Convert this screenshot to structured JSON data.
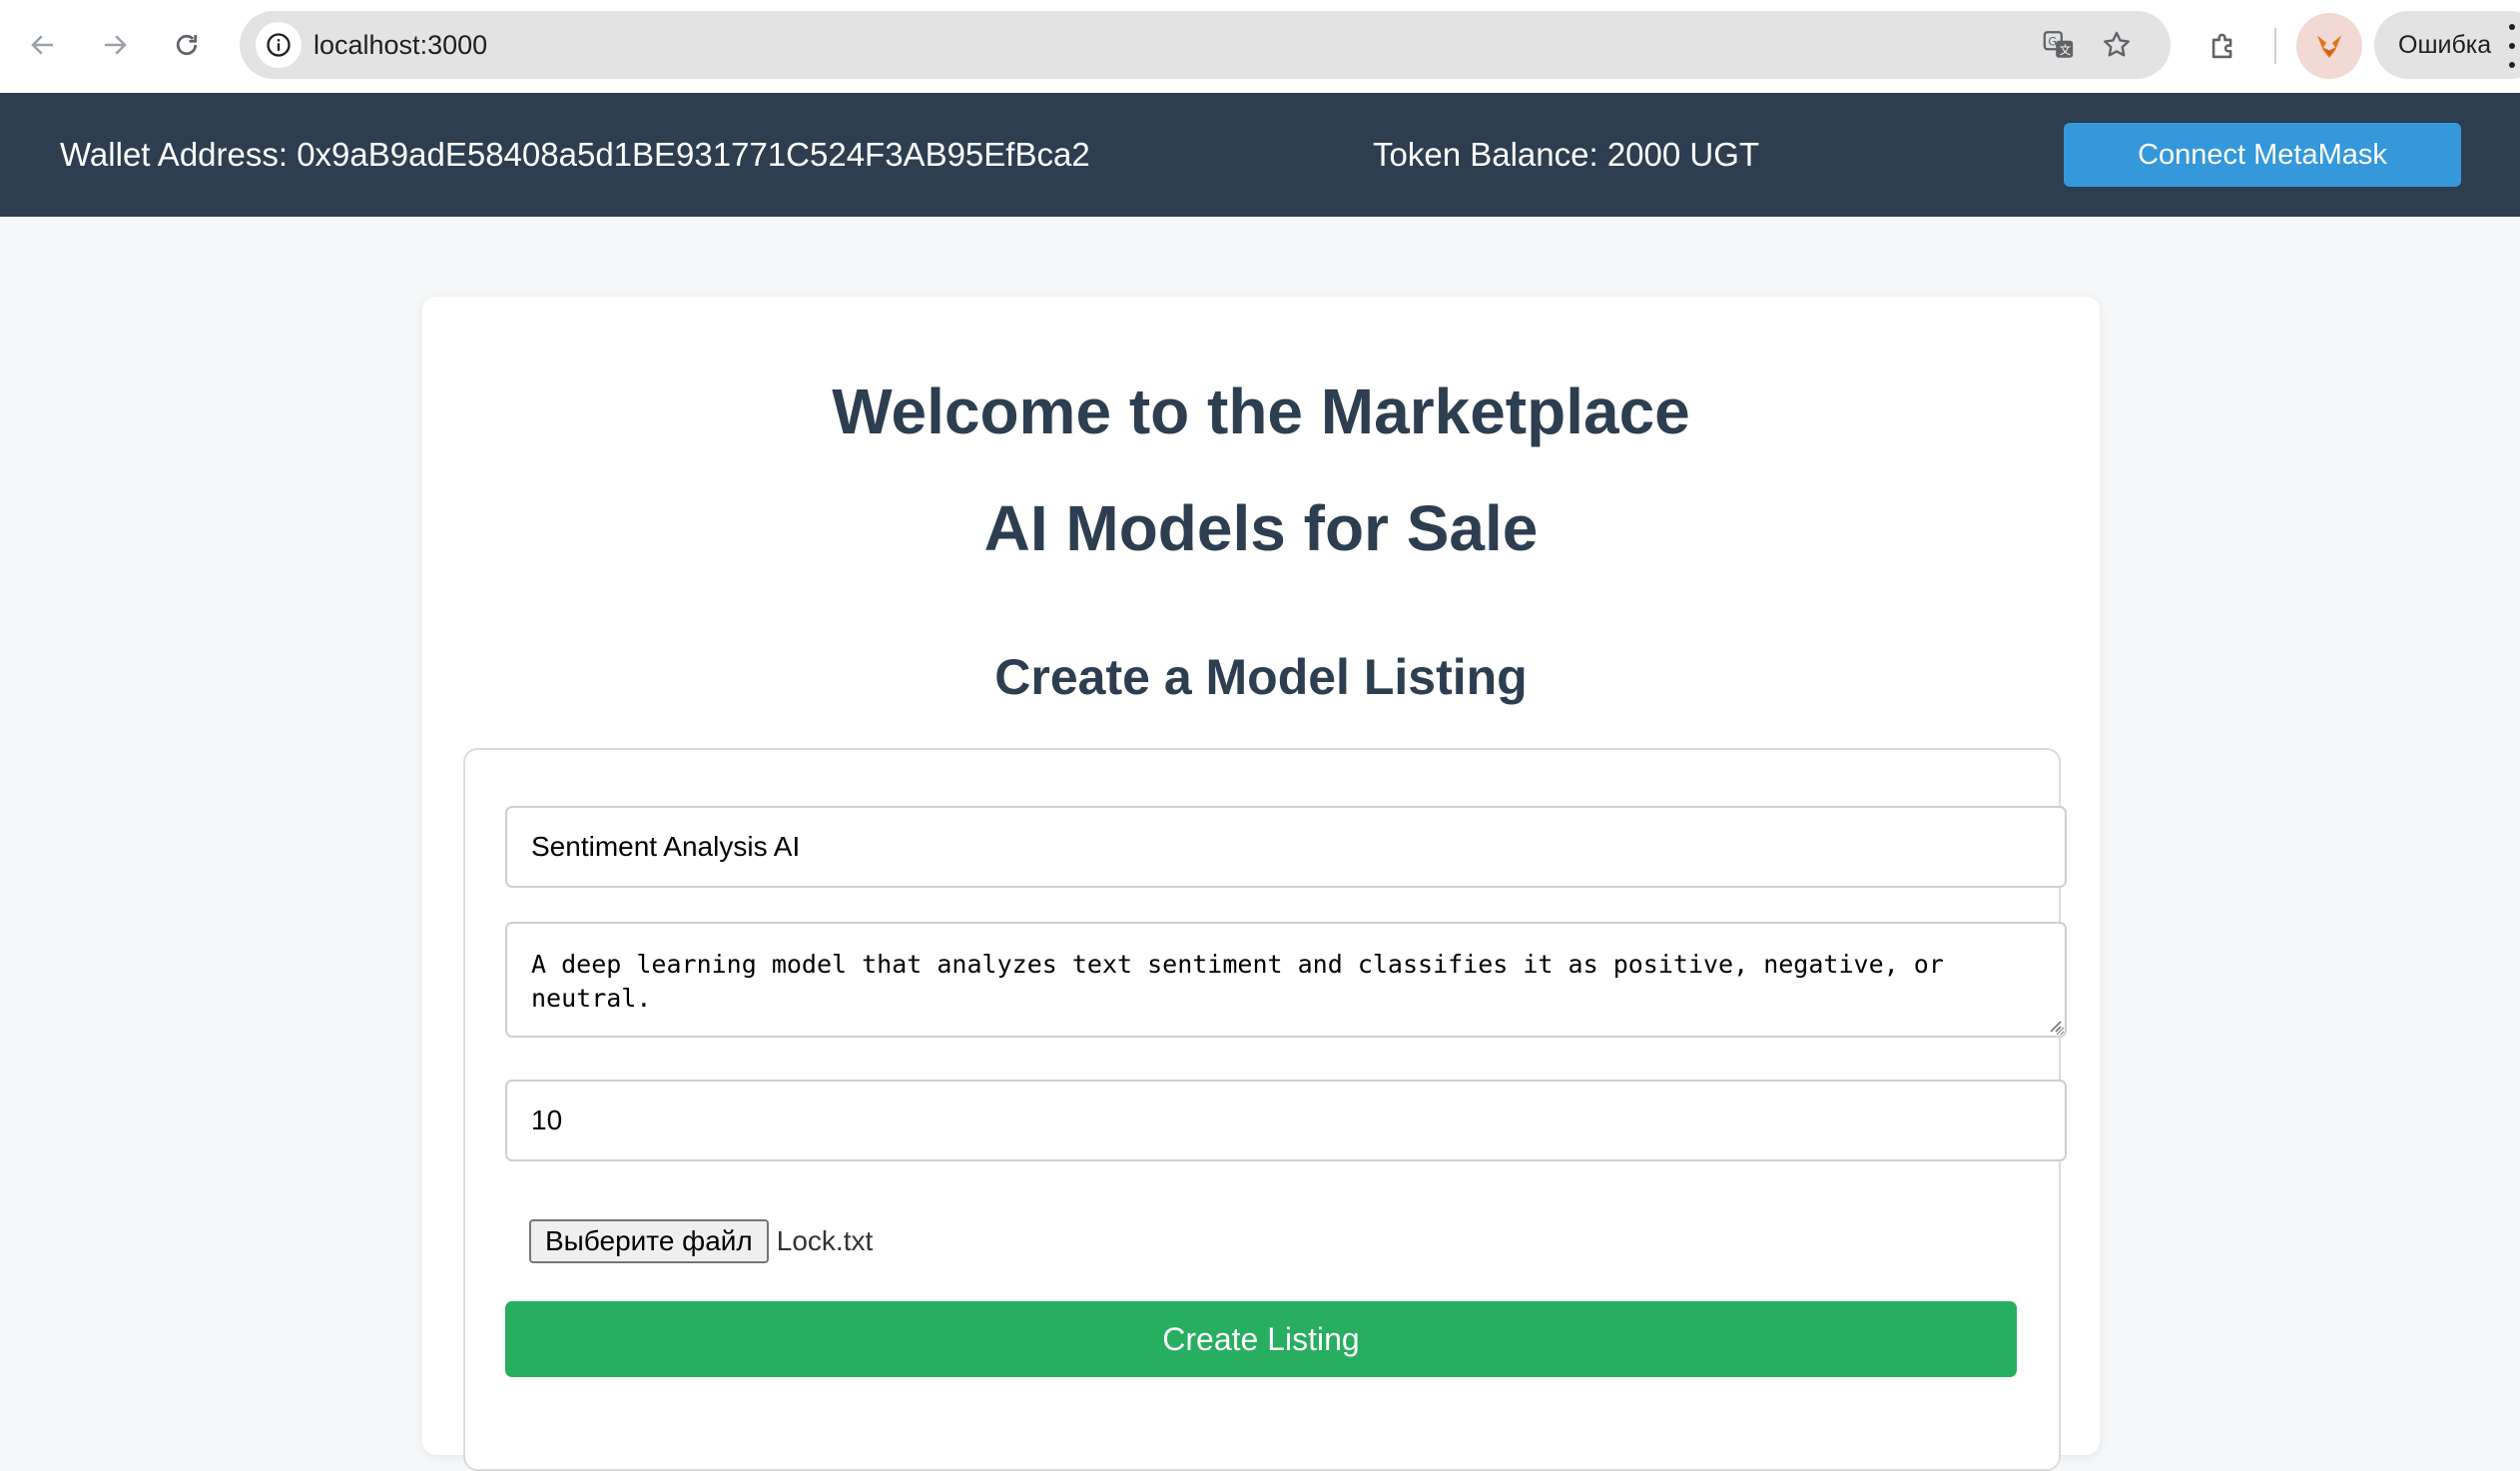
{
  "browser": {
    "url": "localhost:3000",
    "profile_label": "Ошибка",
    "icons": {
      "back": "arrow-left-icon",
      "forward": "arrow-right-icon",
      "reload": "reload-icon",
      "site_info": "info-icon",
      "translate": "translate-icon",
      "bookmark": "star-icon",
      "extensions": "puzzle-icon",
      "menu": "more-vert-icon"
    }
  },
  "header": {
    "wallet_label": "Wallet Address: 0x9aB9adE58408a5d1BE931771C524F3AB95EfBca2",
    "balance_label": "Token Balance: 2000 UGT",
    "connect_button": "Connect MetaMask"
  },
  "main": {
    "title": "Welcome to the Marketplace",
    "subtitle": "AI Models for Sale",
    "form_title": "Create a Model Listing",
    "form": {
      "name_value": "Sentiment Analysis AI",
      "description_value": "A deep learning model that analyzes text sentiment and classifies it as positive, negative, or neutral.",
      "price_value": "10",
      "file_button": "Выберите файл",
      "file_name": "Lock.txt",
      "submit_button": "Create Listing"
    }
  },
  "colors": {
    "header_bg": "#2c3e50",
    "connect_button": "#3498db",
    "create_button": "#27ae60",
    "heading_text": "#2c3e50"
  }
}
